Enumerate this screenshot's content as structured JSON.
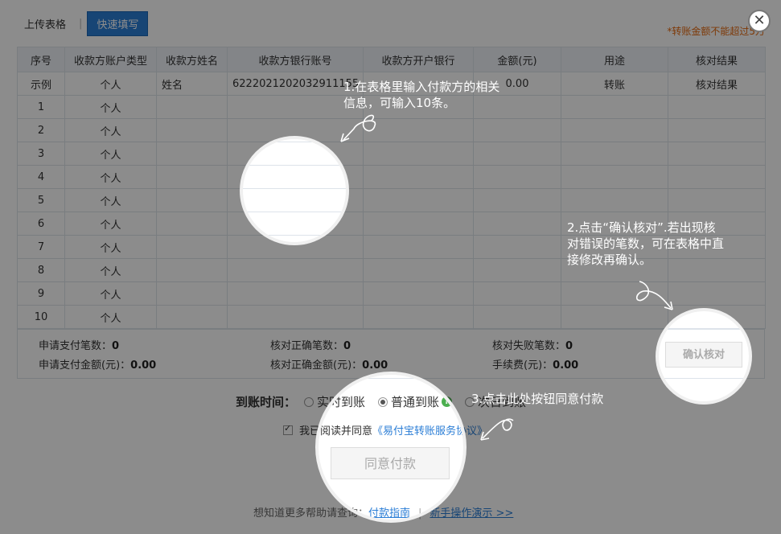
{
  "tabs": {
    "upload": "上传表格",
    "quick_fill": "快速填写"
  },
  "warning": "*转账金额不能超过5万",
  "close_symbol": "✕",
  "table": {
    "headers": [
      "序号",
      "收款方账户类型",
      "收款方姓名",
      "收款方银行账号",
      "收款方开户银行",
      "金额(元)",
      "用途",
      "核对结果"
    ],
    "example": [
      "示例",
      "个人",
      "姓名",
      "6222021202032911155",
      "",
      "0.00",
      "转账",
      "核对结果"
    ],
    "rows": [
      [
        "1",
        "个人"
      ],
      [
        "2",
        "个人"
      ],
      [
        "3",
        "个人"
      ],
      [
        "4",
        "个人"
      ],
      [
        "5",
        "个人"
      ],
      [
        "6",
        "个人"
      ],
      [
        "7",
        "个人"
      ],
      [
        "8",
        "个人"
      ],
      [
        "9",
        "个人"
      ],
      [
        "10",
        "个人"
      ]
    ]
  },
  "summary": {
    "apply_count_label": "申请支付笔数：",
    "apply_count": "0",
    "correct_count_label": "核对正确笔数：",
    "correct_count": "0",
    "fail_count_label": "核对失败笔数：",
    "fail_count": "0",
    "apply_amount_label": "申请支付金额(元)：",
    "apply_amount": "0.00",
    "correct_amount_label": "核对正确金额(元)：",
    "correct_amount": "0.00",
    "fee_label": "手续费(元)：",
    "fee": "0.00"
  },
  "arrival": {
    "label": "到账时间：",
    "options": [
      "实时到账",
      "普通到账",
      "次日到账"
    ],
    "selected": "普通到账"
  },
  "agree": {
    "prefix": "我已阅读并同意",
    "link": "《易付宝转账服务协议》"
  },
  "buttons": {
    "pay": "同意付款",
    "confirm": "确认核对"
  },
  "help": {
    "prefix": "想知道更多帮助请查询：",
    "guide": "付款指南",
    "demo": "新手操作演示 >>"
  },
  "tutorial": {
    "step1": [
      "1.在表格里输入付款方的相关",
      "信息，可输入10条。"
    ],
    "step2": [
      "2.点击“确认核对”.若出现核",
      "对错误的笔数，可在表格中直",
      "接修改再确认。"
    ],
    "step3": "3.点击此处按钮同意付款"
  },
  "colors": {
    "accent": "#2b7ed6",
    "warning": "#e66a10",
    "overlay": "rgba(0,0,0,0.45)"
  }
}
